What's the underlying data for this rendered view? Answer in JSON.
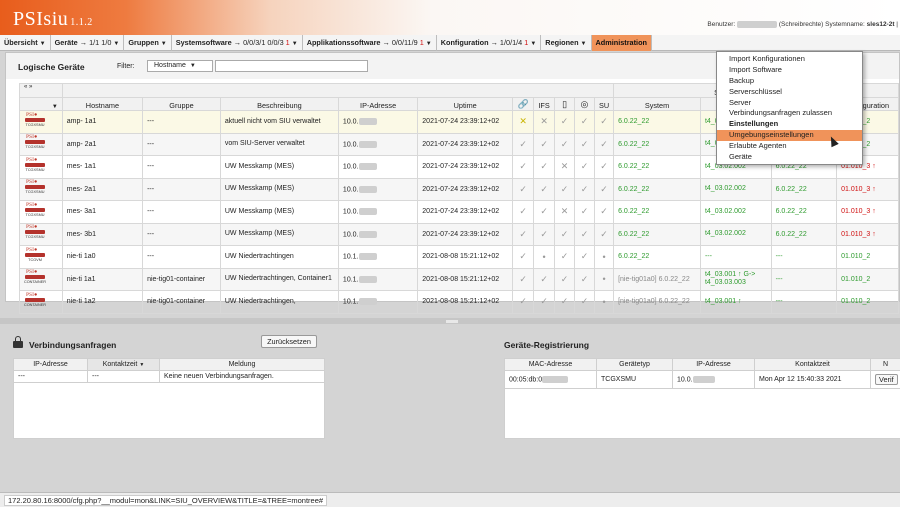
{
  "app": {
    "logo": "PSIsiu",
    "version": "1.1.2",
    "user_prefix": "Benutzer:",
    "user_rights": "(Schreibrechte)",
    "system_label": "Systemname:",
    "system_name": "sles12-2t"
  },
  "menu": [
    {
      "label": "Übersicht",
      "arrow": "",
      "counts": "",
      "red": ""
    },
    {
      "label": "Geräte",
      "arrow": "→",
      "counts": "1/1 1/0",
      "red": ""
    },
    {
      "label": "Gruppen",
      "arrow": "",
      "counts": "",
      "red": ""
    },
    {
      "label": "Systemsoftware",
      "arrow": "→",
      "counts": "0/0/3/1 0/0/3",
      "red": "1"
    },
    {
      "label": "Applikationssoftware",
      "arrow": "→",
      "counts": "0/0/11/9",
      "red": "1"
    },
    {
      "label": "Konfiguration",
      "arrow": "→",
      "counts": "1/0/1/4",
      "red": "1"
    },
    {
      "label": "Regionen",
      "arrow": "",
      "counts": "",
      "red": ""
    },
    {
      "label": "Administration",
      "arrow": "",
      "counts": "",
      "red": ""
    }
  ],
  "logical": {
    "title": "Logische Geräte",
    "filter_label": "Filter:",
    "filter_select": "Hostname",
    "collapse_arrows": "« »",
    "group_header": "S",
    "columns": [
      "Hostname",
      "Gruppe",
      "Beschreibung",
      "IP-Adresse",
      "Uptime",
      "IFS",
      "SU",
      "System",
      "Konfiguration"
    ],
    "rows": [
      {
        "icon": "TCGXSMU",
        "host": "amp-   1a1",
        "group": "---",
        "desc": "aktuell nicht vom SIU verwaltet",
        "ip": "10.0.",
        "uptime": "2021-07-24 23:39:12+02",
        "s": [
          "✕",
          "✕",
          "✓",
          "✓",
          "✓"
        ],
        "system": "6.0.22_22",
        "sys2": "t4_03.02.002",
        "sys3": "",
        "conf": "01.010_2"
      },
      {
        "icon": "TCGXSMU",
        "host": "amp-   2a1",
        "group": "---",
        "desc": "vom SIU-Server verwaltet",
        "ip": "10.0.",
        "uptime": "2021-07-24 23:39:12+02",
        "s": [
          "✓",
          "✓",
          "✓",
          "✓",
          "✓"
        ],
        "system": "6.0.22_22",
        "sys2": "t4_03.02",
        "sys3": "",
        "conf": "01.010_2"
      },
      {
        "icon": "TCGXSMU",
        "host": "mes-   1a1",
        "group": "---",
        "desc": "UW Messkamp (MES)",
        "ip": "10.0.",
        "uptime": "2021-07-24 23:39:12+02",
        "s": [
          "✓",
          "✓",
          "✕",
          "✓",
          "✓"
        ],
        "system": "6.0.22_22",
        "sys2": "t4_03.02.002",
        "sys3": "6.0.22_22",
        "conf": "01.010_3 ↑"
      },
      {
        "icon": "TCGXSMU",
        "host": "mes-   2a1",
        "group": "---",
        "desc": "UW Messkamp (MES)",
        "ip": "10.0.",
        "uptime": "2021-07-24 23:39:12+02",
        "s": [
          "✓",
          "✓",
          "✓",
          "✓",
          "✓"
        ],
        "system": "6.0.22_22",
        "sys2": "t4_03.02.002",
        "sys3": "6.0.22_22",
        "conf": "01.010_3 ↑"
      },
      {
        "icon": "TCGXSMU",
        "host": "mes-   3a1",
        "group": "---",
        "desc": "UW Messkamp (MES)",
        "ip": "10.0.",
        "uptime": "2021-07-24 23:39:12+02",
        "s": [
          "✓",
          "✓",
          "✕",
          "✓",
          "✓"
        ],
        "system": "6.0.22_22",
        "sys2": "t4_03.02.002",
        "sys3": "6.0.22_22",
        "conf": "01.010_3 ↑"
      },
      {
        "icon": "TCGXSMU",
        "host": "mes-   3b1",
        "group": "---",
        "desc": "UW Messkamp (MES)",
        "ip": "10.0.",
        "uptime": "2021-07-24 23:39:12+02",
        "s": [
          "✓",
          "✓",
          "✓",
          "✓",
          "✓"
        ],
        "system": "6.0.22_22",
        "sys2": "t4_03.02.002",
        "sys3": "6.0.22_22",
        "conf": "01.010_3 ↑"
      },
      {
        "icon": "TCGVM",
        "host": "nie-ti   1a0",
        "group": "---",
        "desc": "UW Niedertrachtingen",
        "ip": "10.1.",
        "uptime": "2021-08-08 15:21:12+02",
        "s": [
          "✓",
          "•",
          "✓",
          "✓",
          "•"
        ],
        "system": "6.0.22_22",
        "sys2": "---",
        "sys3": "---",
        "conf": "01.010_2"
      },
      {
        "icon": "CONTAINER",
        "host": "nie-ti   1a1",
        "group": "nie-tig01-container",
        "desc": "UW Niedertrachtingen, Container1",
        "ip": "10.1.",
        "uptime": "2021-08-08 15:21:12+02",
        "s": [
          "✓",
          "✓",
          "✓",
          "✓",
          "•"
        ],
        "system": "[nie-tig01a0] 6.0.22_22",
        "sys2": "t4_03.001 ↑ G-> t4_03.03.003",
        "sys3": "---",
        "conf": "01.010_2"
      },
      {
        "icon": "CONTAINER",
        "host": "nie-ti   1a2",
        "group": "nie-tig01-container",
        "desc": "UW Niedertrachtingen,",
        "ip": "10.1.",
        "uptime": "2021-08-08 15:21:12+02",
        "s": [
          "✓",
          "✓",
          "✓",
          "✓",
          "•"
        ],
        "system": "[nie-tig01a0] 6.0.22_22",
        "sys2": "t4_03.001 ↑",
        "sys3": "---",
        "conf": "01.010_2"
      }
    ]
  },
  "admin_menu": [
    {
      "label": "Import Konfigurationen",
      "bold": false,
      "hover": false
    },
    {
      "label": "Import Software",
      "bold": false,
      "hover": false
    },
    {
      "label": "Backup",
      "bold": false,
      "hover": false
    },
    {
      "label": "Serverschlüssel",
      "bold": false,
      "hover": false
    },
    {
      "label": "Server",
      "bold": false,
      "hover": false
    },
    {
      "label": "Verbindungsanfragen zulassen",
      "bold": false,
      "hover": false
    },
    {
      "label": "Einstellungen",
      "bold": true,
      "hover": false
    },
    {
      "label": "Umgebungseinstellungen",
      "bold": false,
      "hover": true
    },
    {
      "label": "Erlaubte Agenten",
      "bold": false,
      "hover": false
    },
    {
      "label": "Geräte",
      "bold": false,
      "hover": false
    }
  ],
  "verbindungen": {
    "title": "Verbindungsanfragen",
    "reset": "Zurücksetzen",
    "columns": [
      "IP-Adresse",
      "Kontaktzeit",
      "Meldung"
    ],
    "sort_indicator": "▼",
    "row": [
      "---",
      "---",
      "Keine neuen Verbindungsanfragen."
    ]
  },
  "registrierung": {
    "title": "Geräte-Registrierung",
    "columns": [
      "MAC-Adresse",
      "Gerätetyp",
      "IP-Adresse",
      "Kontaktzeit",
      "N"
    ],
    "row": [
      "00:05:db:0",
      "TCGXSMU",
      "10.0.",
      "Mon Apr 12 15:40:33 2021",
      "Verif"
    ]
  },
  "status_url": "172.20.80.16:8000/cfg.php?__modul=mon&LINK=SIU_OVERVIEW&TITLE=&TREE=montree#"
}
